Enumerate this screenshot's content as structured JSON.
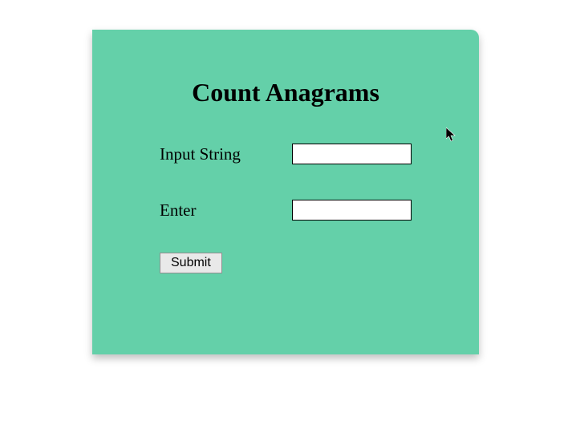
{
  "card": {
    "title": "Count Anagrams",
    "fields": [
      {
        "label": "Input String",
        "value": ""
      },
      {
        "label": "Enter",
        "value": ""
      }
    ],
    "submit_label": "Submit"
  }
}
